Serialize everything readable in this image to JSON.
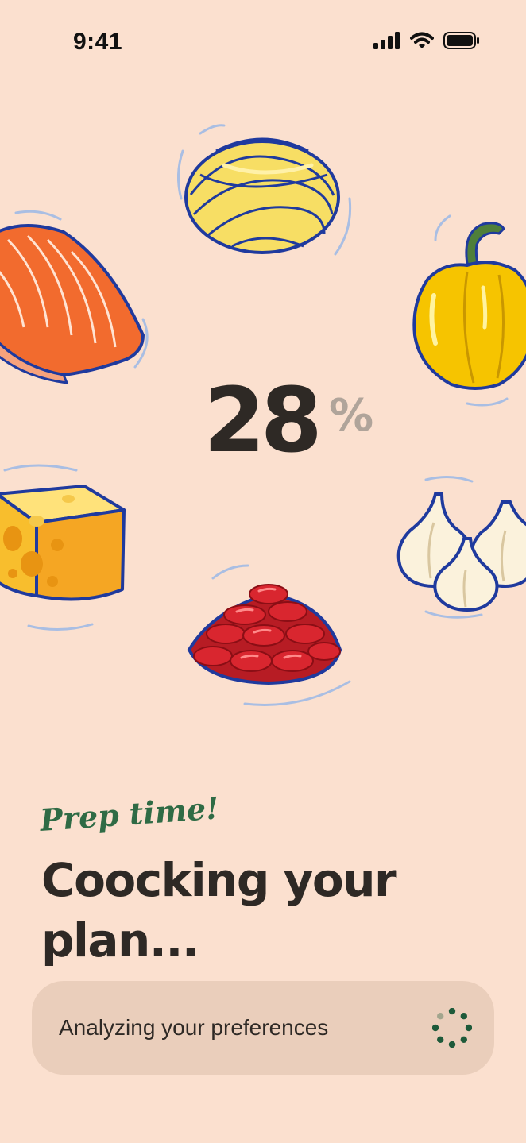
{
  "status_bar": {
    "time": "9:41",
    "icons": [
      "signal-icon",
      "wifi-icon",
      "battery-icon"
    ]
  },
  "illustrations": [
    "pasta-nest",
    "salmon-fillet",
    "yellow-bell-pepper",
    "cheese-wedge",
    "red-kidney-beans",
    "garlic-bulbs"
  ],
  "progress": {
    "value": "28",
    "unit": "%"
  },
  "content": {
    "kicker": "Prep time!",
    "headline": "Coocking your plan...",
    "status_message": "Analyzing your preferences"
  },
  "colors": {
    "background": "#FBE0CF",
    "card": "#EACEBB",
    "text": "#2E2925",
    "accent_green": "#2F6B45",
    "percent_gray": "#B0A49A",
    "outline_blue": "#1F3A9E"
  }
}
